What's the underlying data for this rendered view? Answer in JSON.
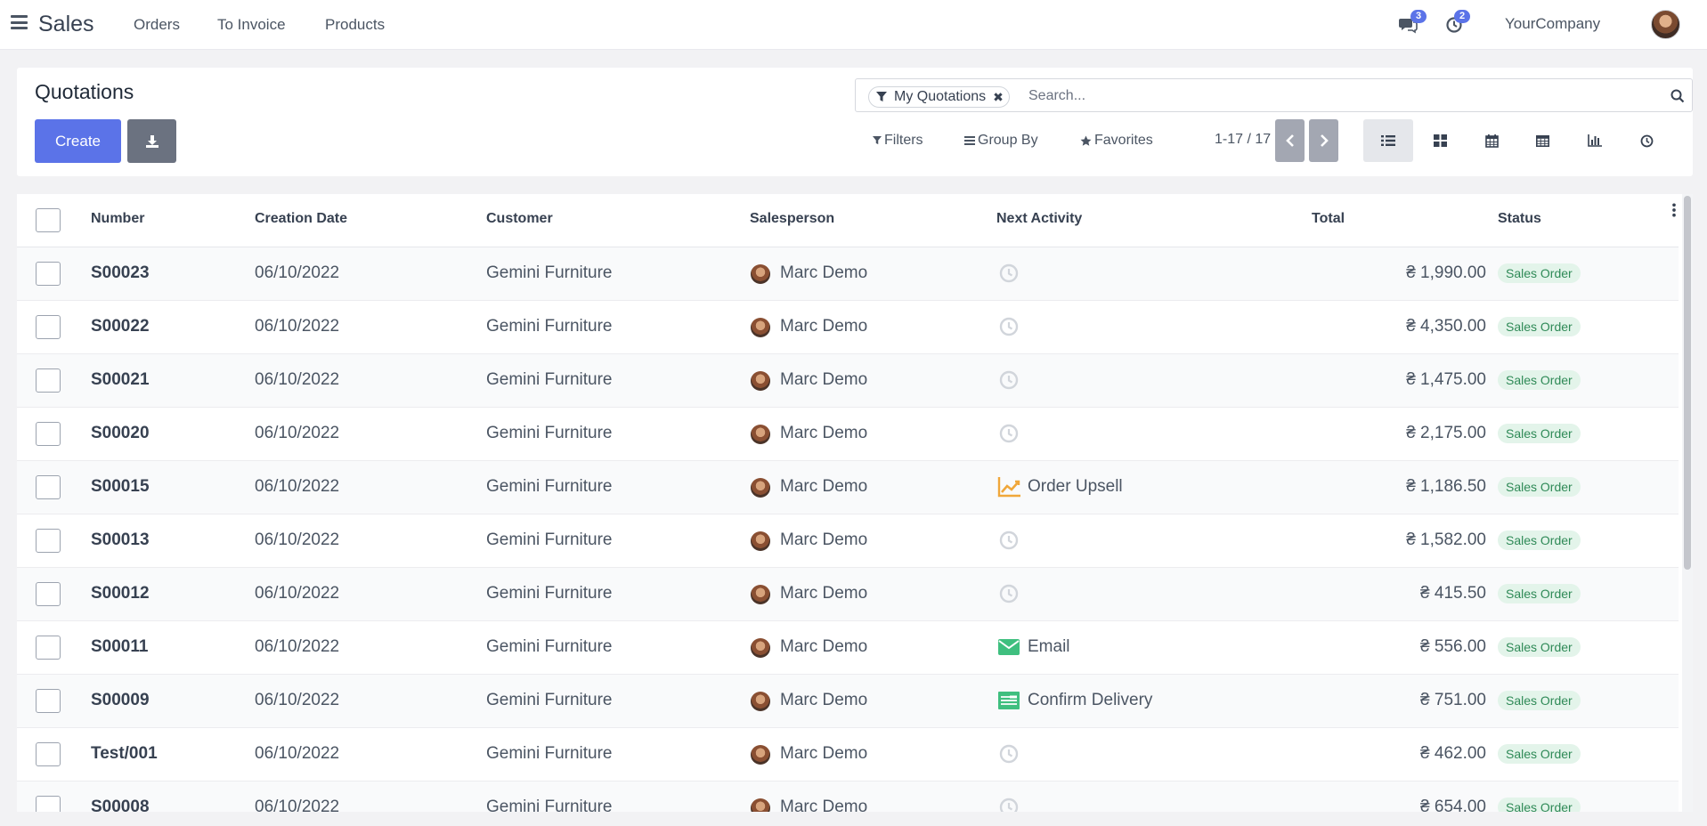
{
  "topbar": {
    "app_name": "Sales",
    "menu": [
      "Orders",
      "To Invoice",
      "Products"
    ],
    "messages_count": "3",
    "activities_count": "2",
    "company": "YourCompany"
  },
  "control_panel": {
    "breadcrumb": "Quotations",
    "create_label": "Create",
    "search": {
      "facet": "My Quotations",
      "placeholder": "Search..."
    },
    "filters_label": "Filters",
    "groupby_label": "Group By",
    "favorites_label": "Favorites",
    "pager": "1-17 / 17",
    "views": [
      "list",
      "kanban",
      "calendar",
      "pivot",
      "graph",
      "activity"
    ],
    "active_view": "list"
  },
  "table": {
    "headers": {
      "number": "Number",
      "date": "Creation Date",
      "customer": "Customer",
      "salesperson": "Salesperson",
      "activity": "Next Activity",
      "total": "Total",
      "status": "Status"
    },
    "rows": [
      {
        "number": "S00023",
        "date": "06/10/2022",
        "customer": "Gemini Furniture",
        "salesperson": "Marc Demo",
        "activity_icon": "clock-icon",
        "activity": "",
        "total": "₴ 1,990.00",
        "status": "Sales Order"
      },
      {
        "number": "S00022",
        "date": "06/10/2022",
        "customer": "Gemini Furniture",
        "salesperson": "Marc Demo",
        "activity_icon": "clock-icon",
        "activity": "",
        "total": "₴ 4,350.00",
        "status": "Sales Order"
      },
      {
        "number": "S00021",
        "date": "06/10/2022",
        "customer": "Gemini Furniture",
        "salesperson": "Marc Demo",
        "activity_icon": "clock-icon",
        "activity": "",
        "total": "₴ 1,475.00",
        "status": "Sales Order"
      },
      {
        "number": "S00020",
        "date": "06/10/2022",
        "customer": "Gemini Furniture",
        "salesperson": "Marc Demo",
        "activity_icon": "clock-icon",
        "activity": "",
        "total": "₴ 2,175.00",
        "status": "Sales Order"
      },
      {
        "number": "S00015",
        "date": "06/10/2022",
        "customer": "Gemini Furniture",
        "salesperson": "Marc Demo",
        "activity_icon": "upsell-chart-icon",
        "activity": "Order Upsell",
        "total": "₴ 1,186.50",
        "status": "Sales Order"
      },
      {
        "number": "S00013",
        "date": "06/10/2022",
        "customer": "Gemini Furniture",
        "salesperson": "Marc Demo",
        "activity_icon": "clock-icon",
        "activity": "",
        "total": "₴ 1,582.00",
        "status": "Sales Order"
      },
      {
        "number": "S00012",
        "date": "06/10/2022",
        "customer": "Gemini Furniture",
        "salesperson": "Marc Demo",
        "activity_icon": "clock-icon",
        "activity": "",
        "total": "₴ 415.50",
        "status": "Sales Order"
      },
      {
        "number": "S00011",
        "date": "06/10/2022",
        "customer": "Gemini Furniture",
        "salesperson": "Marc Demo",
        "activity_icon": "email-icon",
        "activity": "Email",
        "total": "₴ 556.00",
        "status": "Sales Order"
      },
      {
        "number": "S00009",
        "date": "06/10/2022",
        "customer": "Gemini Furniture",
        "salesperson": "Marc Demo",
        "activity_icon": "delivery-tasks-icon",
        "activity": "Confirm Delivery",
        "total": "₴ 751.00",
        "status": "Sales Order"
      },
      {
        "number": "Test/001",
        "date": "06/10/2022",
        "customer": "Gemini Furniture",
        "salesperson": "Marc Demo",
        "activity_icon": "clock-icon",
        "activity": "",
        "total": "₴ 462.00",
        "status": "Sales Order"
      },
      {
        "number": "S00008",
        "date": "06/10/2022",
        "customer": "Gemini Furniture",
        "salesperson": "Marc Demo",
        "activity_icon": "clock-icon",
        "activity": "",
        "total": "₴ 654.00",
        "status": "Sales Order"
      }
    ]
  },
  "colors": {
    "primary": "#5b73e8",
    "status_bg": "#e3f4ea",
    "status_text": "#2f8a57",
    "activity_upsell": "#f0a73a",
    "activity_done": "#3fbf7f"
  }
}
